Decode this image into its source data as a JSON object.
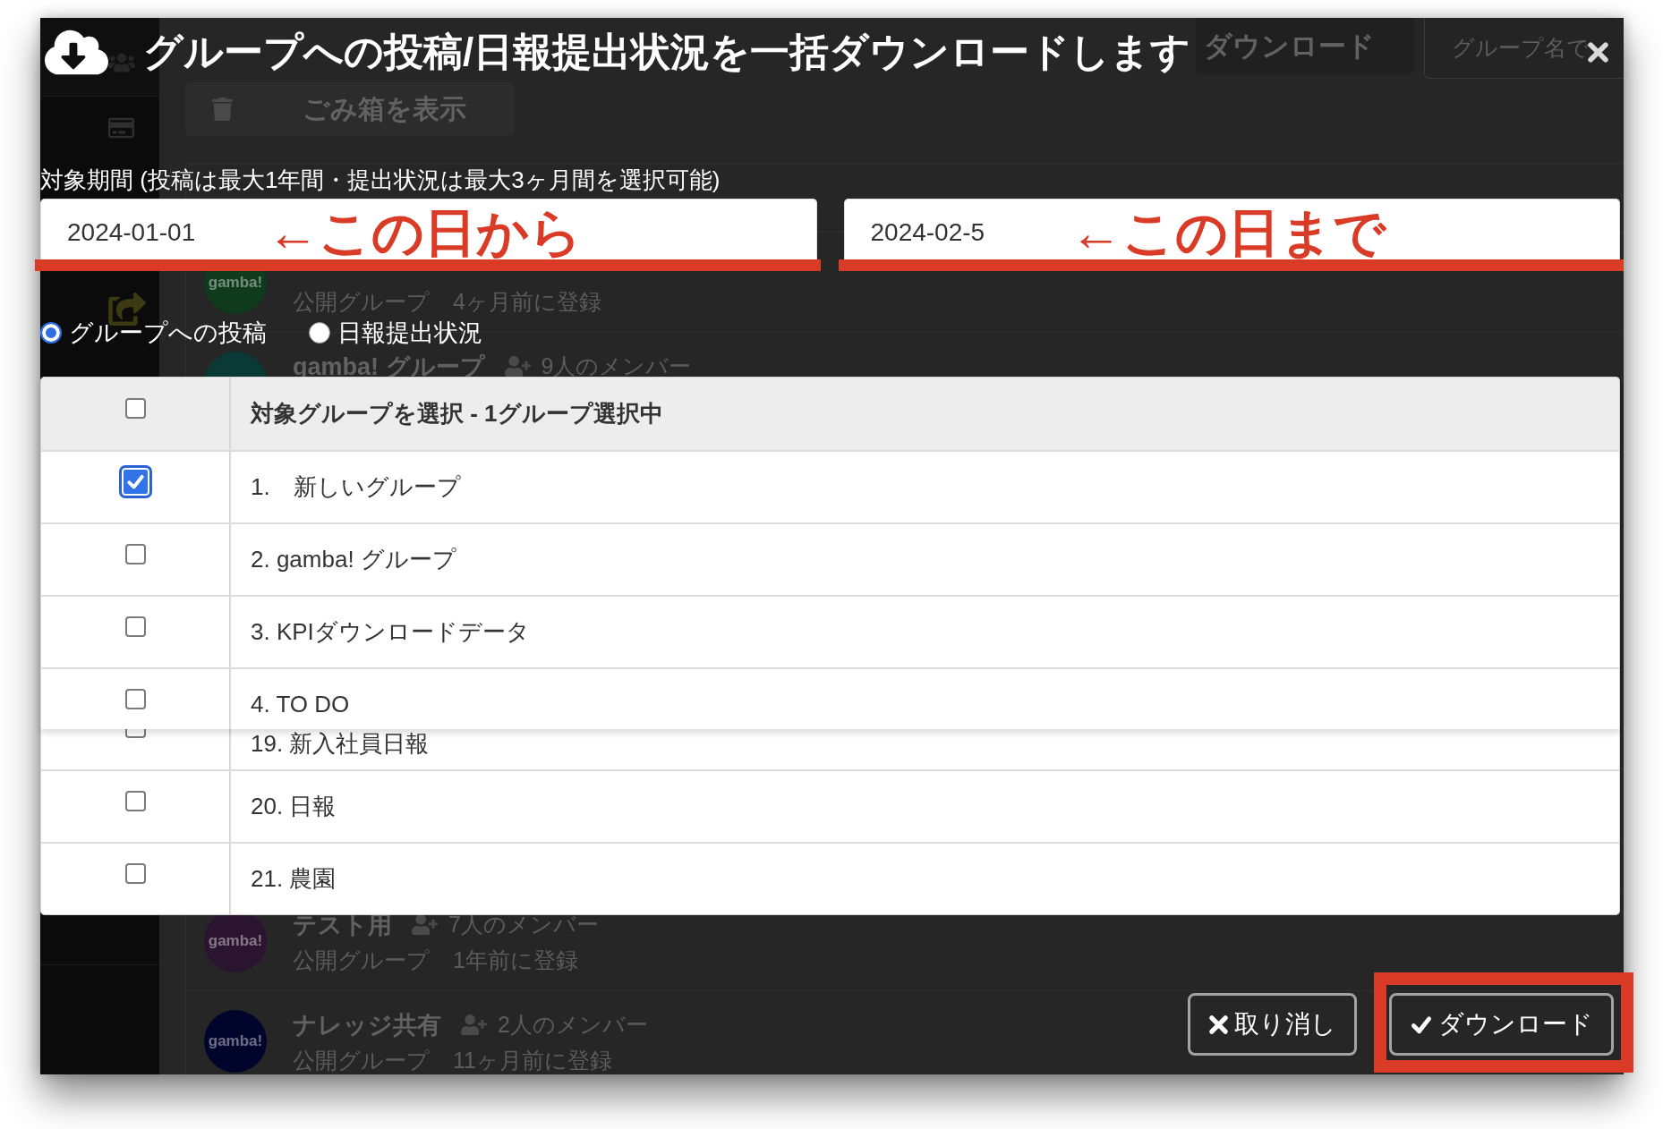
{
  "window": {
    "title": "グループへの投稿/日報提出状況を一括ダウンロードします"
  },
  "period": {
    "label": "対象期間 (投稿は最大1年間・提出状況は最大3ヶ月間を選択可能)",
    "fields": [
      {
        "value": "2024-01-01",
        "annotation": "←この日から"
      },
      {
        "value": "2024-02-5",
        "annotation": "←この日まで"
      }
    ]
  },
  "options": [
    {
      "label": "グループへの投稿",
      "selected": true
    },
    {
      "label": "日報提出状況",
      "selected": false
    }
  ],
  "table": {
    "header": {
      "title": "対象グループを選択 - 1グループ選択中",
      "checked": false
    },
    "rows": [
      {
        "label": "1.　新しいグループ",
        "checked": true
      },
      {
        "label": "2. gamba! グループ",
        "checked": false
      },
      {
        "label": "3. KPIダウンロードデータ",
        "checked": false
      },
      {
        "label": "4. TO DO",
        "checked": false
      }
    ],
    "rows_continued": [
      {
        "kind": "partial",
        "label": "19. 新入社員日報",
        "checked": false
      },
      {
        "kind": "row",
        "label": "20. 日報",
        "checked": false
      },
      {
        "kind": "row",
        "label": "21. 農園",
        "checked": false
      }
    ]
  },
  "buttons": [
    {
      "kind": "cancel",
      "label": "取り消し",
      "highlighted": false
    },
    {
      "kind": "download",
      "label": "ダウンロード",
      "highlighted": true
    }
  ],
  "background_page": {
    "toolbar": {
      "download_button": "ダウンロード",
      "search": {
        "placeholder": "グループ名で"
      },
      "trash_button": "ごみ箱を表示"
    },
    "groups_top": [
      {
        "avatar_text": "gamba!",
        "color": "#0f3b1c",
        "visibility": "公開グループ",
        "registered": "4ヶ月前に登録"
      },
      {
        "color": "#0b3935",
        "name": "gamba! グループ",
        "members": "9人のメンバー"
      }
    ],
    "groups_bottom": [
      {
        "avatar_text": "gamba!",
        "color": "#2a1430",
        "name": "テスト用",
        "members": "7人のメンバー",
        "visibility": "公開グループ",
        "registered": "1年前に登録"
      },
      {
        "avatar_text": "gamba!",
        "color": "#01052c",
        "name": "ナレッジ共有",
        "members": "2人のメンバー",
        "visibility": "公開グループ",
        "registered": "11ヶ月前に登録"
      }
    ]
  }
}
